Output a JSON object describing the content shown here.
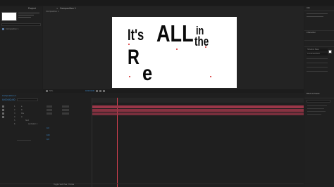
{
  "project_panel": {
    "tab": "Project",
    "item_label": "Composition 1",
    "search_placeholder": ""
  },
  "comp_panel": {
    "tab": "Composition 1",
    "view_label": "Composition 1",
    "zoom": "50%",
    "time": "0;00;02;00"
  },
  "comp_text": {
    "its": "It's",
    "all": "ALL",
    "in": "in",
    "the": "the",
    "r": "R",
    "e": "e"
  },
  "right_panel": {
    "tab_top": "Info",
    "tab_mid": "Character",
    "tab_effects": "Effects & Presets",
    "font_name": "Helvetica Neue",
    "font_style": "Condensed Bold"
  },
  "timeline": {
    "tab": "Composition 1",
    "time": "0;00;02;00",
    "layers": [
      {
        "num": "1",
        "name": "e"
      },
      {
        "num": "2",
        "name": "R"
      },
      {
        "num": "3",
        "name": "the"
      },
      {
        "num": "4",
        "name": "in"
      },
      {
        "num": "5",
        "name": "Text"
      },
      {
        "num": "6",
        "name": "Animator 1"
      }
    ],
    "footer": "Toggle Switches / Modes"
  },
  "colors": {
    "accent": "#3d8fd6",
    "bar": "#9a3648",
    "marker": "#d42020",
    "comp_bg": "#ffffff"
  },
  "icons": [
    "close-icon",
    "dropdown-icon",
    "eye-icon",
    "lock-icon",
    "playhead-icon"
  ]
}
